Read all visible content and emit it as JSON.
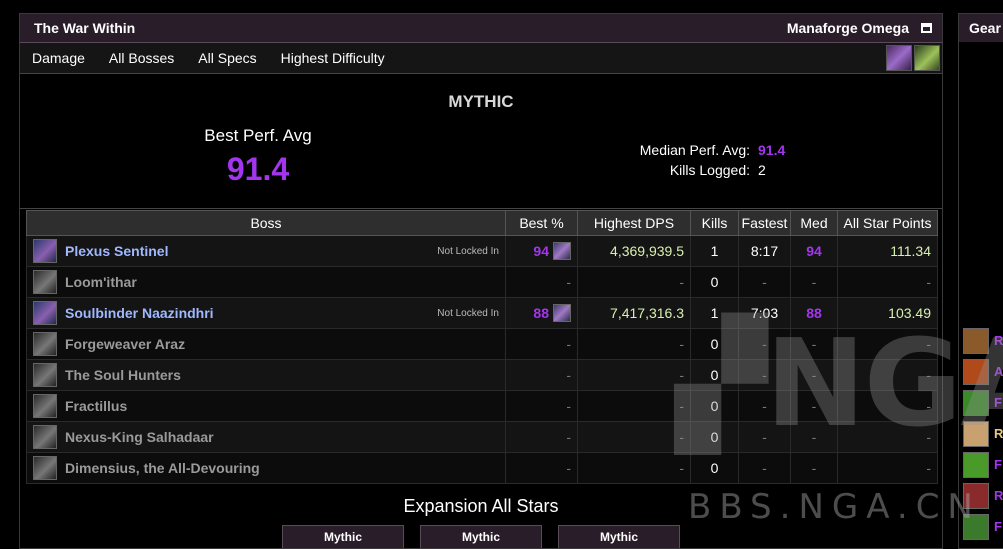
{
  "window": {
    "title": "The War Within",
    "raid": "Manaforge Omega"
  },
  "toolbar": {
    "items": [
      "Damage",
      "All Bosses",
      "All Specs",
      "Highest Difficulty"
    ]
  },
  "summary": {
    "difficulty": "MYTHIC",
    "best_label": "Best Perf. Avg",
    "best_value": "91.4",
    "median_label": "Median Perf. Avg:",
    "median_value": "91.4",
    "kills_label": "Kills Logged:",
    "kills_value": "2"
  },
  "table": {
    "headers": [
      "Boss",
      "Best %",
      "Highest DPS",
      "Kills",
      "Fastest",
      "Med",
      "All Star Points"
    ],
    "rows": [
      {
        "name": "Plexus Sentinel",
        "note": "Not Locked In",
        "best": "94",
        "dps": "4,369,939.5",
        "kills": "1",
        "fastest": "8:17",
        "med": "94",
        "points": "111.34",
        "active": true
      },
      {
        "name": "Loom'ithar",
        "note": "",
        "best": "-",
        "dps": "-",
        "kills": "0",
        "fastest": "-",
        "med": "-",
        "points": "-",
        "active": false
      },
      {
        "name": "Soulbinder Naazindhri",
        "note": "Not Locked In",
        "best": "88",
        "dps": "7,417,316.3",
        "kills": "1",
        "fastest": "7:03",
        "med": "88",
        "points": "103.49",
        "active": true
      },
      {
        "name": "Forgeweaver Araz",
        "note": "",
        "best": "-",
        "dps": "-",
        "kills": "0",
        "fastest": "-",
        "med": "-",
        "points": "-",
        "active": false
      },
      {
        "name": "The Soul Hunters",
        "note": "",
        "best": "-",
        "dps": "-",
        "kills": "0",
        "fastest": "-",
        "med": "-",
        "points": "-",
        "active": false
      },
      {
        "name": "Fractillus",
        "note": "",
        "best": "-",
        "dps": "-",
        "kills": "0",
        "fastest": "-",
        "med": "-",
        "points": "-",
        "active": false
      },
      {
        "name": "Nexus-King Salhadaar",
        "note": "",
        "best": "-",
        "dps": "-",
        "kills": "0",
        "fastest": "-",
        "med": "-",
        "points": "-",
        "active": false
      },
      {
        "name": "Dimensius, the All-Devouring",
        "note": "",
        "best": "-",
        "dps": "-",
        "kills": "0",
        "fastest": "-",
        "med": "-",
        "points": "-",
        "active": false
      }
    ]
  },
  "allstars": {
    "title": "Expansion All Stars",
    "tabs": [
      "Mythic",
      "Mythic",
      "Mythic"
    ]
  },
  "gear": {
    "title": "Gear",
    "items": [
      {
        "text": "R",
        "color": "#a335ee",
        "icon_bg": "#8a5a2a"
      },
      {
        "text": "A",
        "color": "#a335ee",
        "icon_bg": "#b04a1a"
      },
      {
        "text": "F",
        "color": "#a335ee",
        "icon_bg": "#3a8a2a"
      },
      {
        "text": "R",
        "color": "#e6cc80",
        "icon_bg": "#c9a070"
      },
      {
        "text": "F",
        "color": "#a335ee",
        "icon_bg": "#4a9a2a"
      },
      {
        "text": "R",
        "color": "#a335ee",
        "icon_bg": "#8a2a2a"
      },
      {
        "text": "F",
        "color": "#a335ee",
        "icon_bg": "#3a7a2a"
      }
    ]
  },
  "watermark": {
    "logo": "NGA",
    "url": "BBS.NGA.CN"
  },
  "colors": {
    "epic": "#a335ee",
    "accent_title_bg": "#2a1d2a"
  }
}
